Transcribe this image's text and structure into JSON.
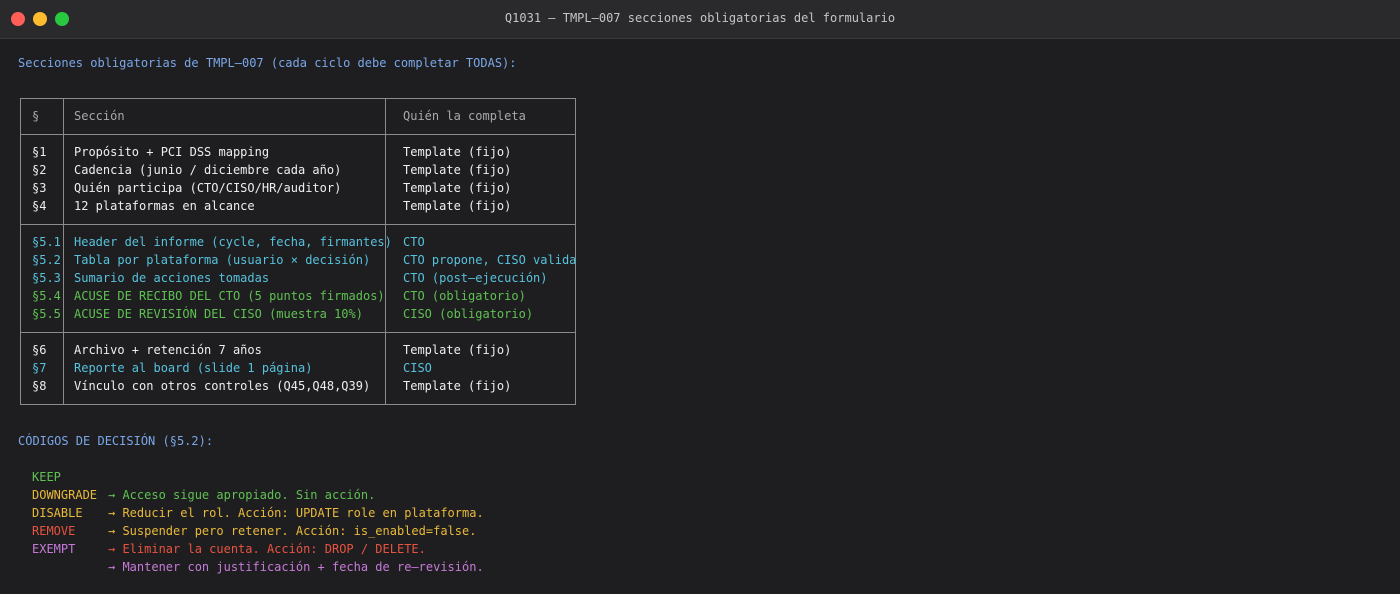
{
  "window": {
    "title": "Q1031 — TMPL—007 secciones obligatorias del formulario"
  },
  "intro": "Secciones obligatorias de TMPL—007 (cada ciclo debe completar TODAS):",
  "table": {
    "headers": {
      "sec": "§",
      "name": "Sección",
      "who": "Quién la completa"
    },
    "group1": [
      {
        "sec": "§1",
        "name": "Propósito + PCI DSS mapping",
        "who": "Template (fijo)"
      },
      {
        "sec": "§2",
        "name": "Cadencia (junio / diciembre cada año)",
        "who": "Template (fijo)"
      },
      {
        "sec": "§3",
        "name": "Quién participa (CTO/CISO/HR/auditor)",
        "who": "Template (fijo)"
      },
      {
        "sec": "§4",
        "name": "12 plataformas en alcance",
        "who": "Template (fijo)"
      }
    ],
    "group2": [
      {
        "sec": "§5.1",
        "name": "Header del informe (cycle, fecha, firmantes)",
        "who": "CTO"
      },
      {
        "sec": "§5.2",
        "name": "Tabla por plataforma (usuario × decisión)",
        "who": "CTO propone, CISO valida"
      },
      {
        "sec": "§5.3",
        "name": "Sumario de acciones tomadas",
        "who": "CTO (post—ejecución)"
      },
      {
        "sec": "§5.4",
        "name": "ACUSE DE RECIBO DEL CTO (5 puntos firmados)",
        "who": "CTO (obligatorio)"
      },
      {
        "sec": "§5.5",
        "name": "ACUSE DE REVISIÓN DEL CISO (muestra 10%)",
        "who": "CISO (obligatorio)"
      }
    ],
    "group3": [
      {
        "sec": "§6",
        "name": "Archivo + retención 7 años",
        "who": "Template (fijo)"
      },
      {
        "sec": "§7",
        "name": "Reporte al board (slide 1 página)",
        "who": "CISO"
      },
      {
        "sec": "§8",
        "name": "Vínculo con otros controles (Q45,Q48,Q39)",
        "who": "Template (fijo)"
      }
    ]
  },
  "codes": {
    "heading": "CÓDIGOS DE DECISIÓN (§5.2):",
    "items": [
      {
        "code": "KEEP",
        "desc": "→ Acceso sigue apropiado. Sin acción.",
        "color": "#5fc151"
      },
      {
        "code": "DOWNGRADE",
        "desc": "→ Reducir el rol. Acción: UPDATE role en plataforma.",
        "color": "#e9b93a"
      },
      {
        "code": "DISABLE",
        "desc": "→ Suspender pero retener. Acción: is_enabled=false.",
        "color": "#e9b93a"
      },
      {
        "code": "REMOVE",
        "desc": "→ Eliminar la cuenta. Acción: DROP / DELETE.",
        "color": "#e8533f"
      },
      {
        "code": "EXEMPT",
        "desc": "→ Mantener con justificación + fecha de re—revisión.",
        "color": "#c67ad8"
      }
    ]
  }
}
